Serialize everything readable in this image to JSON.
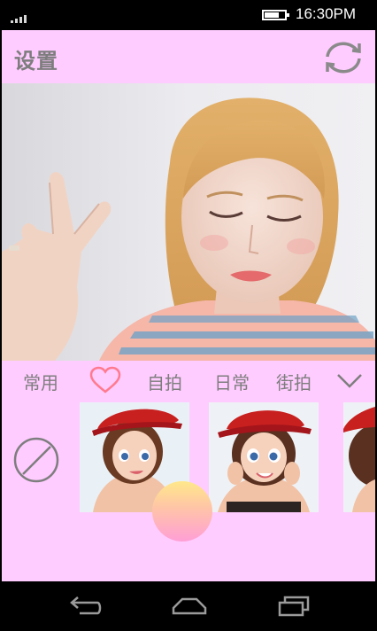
{
  "status_bar": {
    "time": "16:30PM",
    "signal_icon": "signal-bars-icon",
    "battery_icon": "battery-icon"
  },
  "header": {
    "title": "设置",
    "switch_camera_icon": "camera-switch-icon"
  },
  "preview": {
    "description_icon": "camera-preview"
  },
  "filter_tabs": [
    {
      "label": "常用"
    },
    {
      "label": "",
      "icon": "heart-icon"
    },
    {
      "label": "自拍"
    },
    {
      "label": "日常"
    },
    {
      "label": "街拍"
    },
    {
      "label": "",
      "icon": "chevron-down-icon"
    }
  ],
  "stickers": {
    "none_icon": "no-sticker-icon",
    "items": [
      {
        "name": "cartoon-girl-red-hat-1"
      },
      {
        "name": "cartoon-girl-red-hat-2"
      },
      {
        "name": "cartoon-girl-red-hat-3"
      }
    ]
  },
  "capture": {
    "icon": "shutter-button"
  },
  "nav_bar": {
    "back_icon": "back-icon",
    "home_icon": "home-icon",
    "recents_icon": "recents-icon"
  },
  "colors": {
    "app_bg": "#ffccff",
    "text_gray": "#7e7e7e",
    "heart": "#ff7a8f",
    "shutter_top": "#ffe88a",
    "shutter_bottom": "#ff9fd6"
  }
}
